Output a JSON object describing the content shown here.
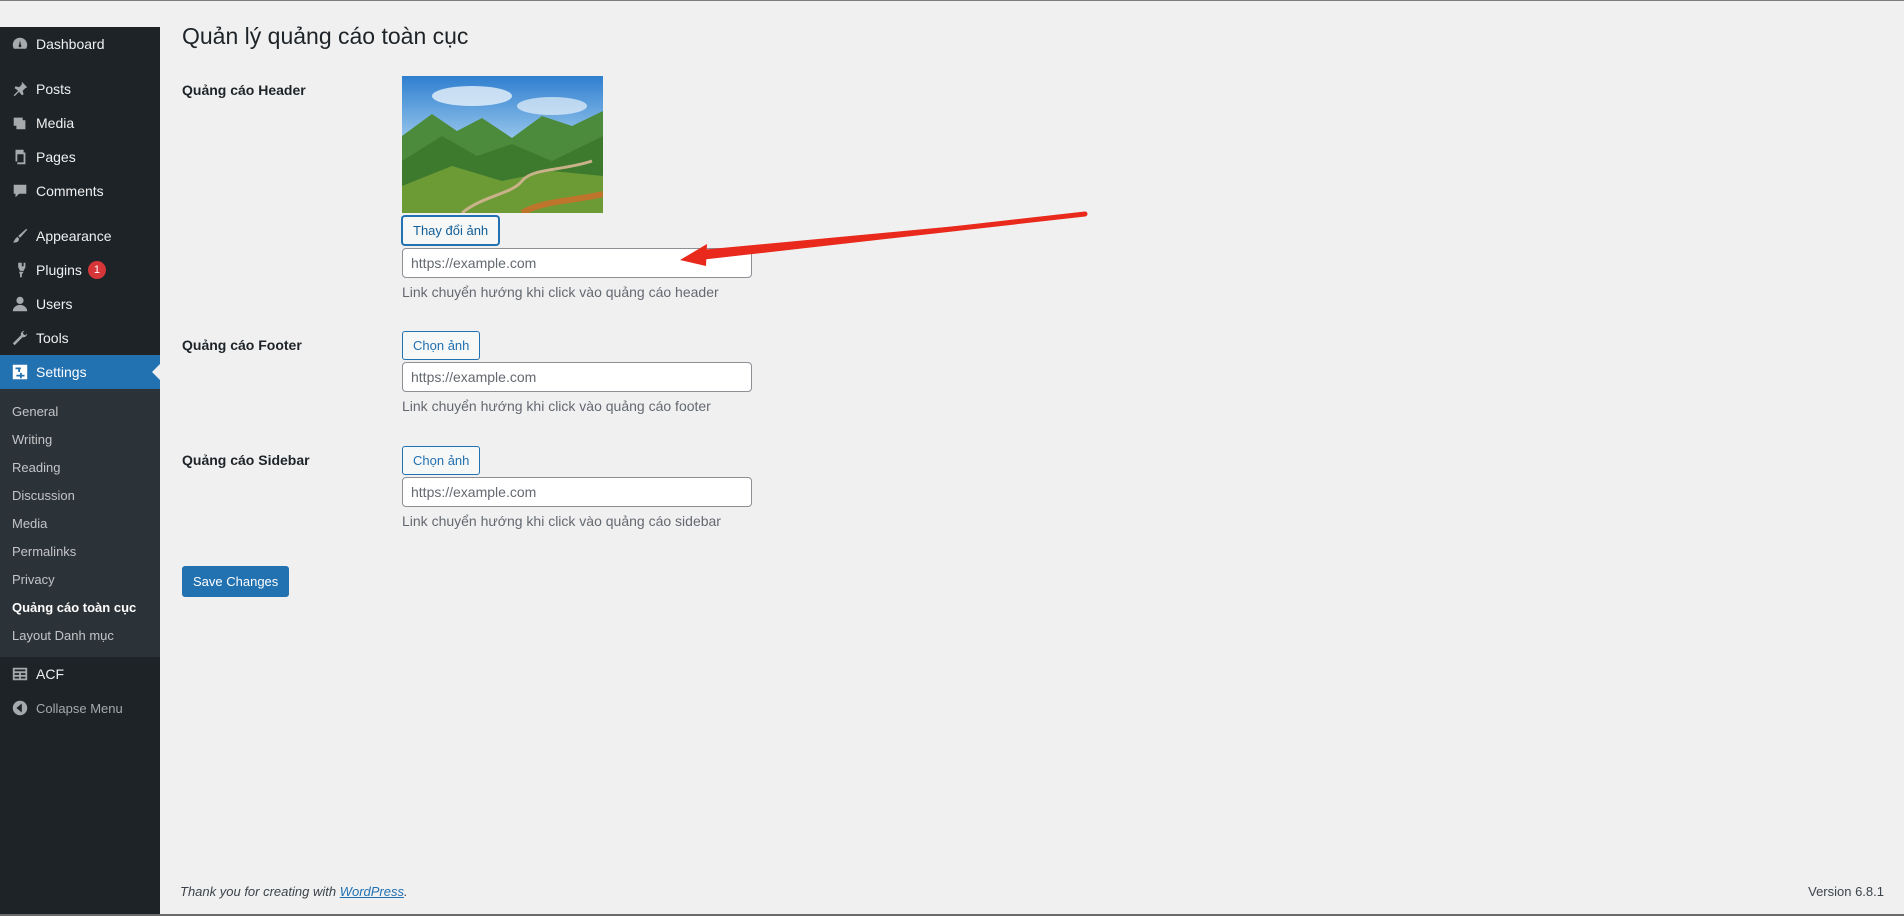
{
  "sidebar": {
    "items": [
      {
        "label": "Dashboard",
        "icon": "dashboard-icon"
      },
      {
        "label": "Posts",
        "icon": "pin-icon"
      },
      {
        "label": "Media",
        "icon": "media-icon"
      },
      {
        "label": "Pages",
        "icon": "pages-icon"
      },
      {
        "label": "Comments",
        "icon": "comment-icon"
      },
      {
        "label": "Appearance",
        "icon": "brush-icon"
      },
      {
        "label": "Plugins",
        "icon": "plugin-icon",
        "badge": "1"
      },
      {
        "label": "Users",
        "icon": "user-icon"
      },
      {
        "label": "Tools",
        "icon": "wrench-icon"
      },
      {
        "label": "Settings",
        "icon": "settings-icon"
      }
    ],
    "submenu": [
      "General",
      "Writing",
      "Reading",
      "Discussion",
      "Media",
      "Permalinks",
      "Privacy",
      "Quảng cáo toàn cục",
      "Layout Danh mục"
    ],
    "acf": "ACF",
    "collapse": "Collapse Menu"
  },
  "page": {
    "title": "Quản lý quảng cáo toàn cục",
    "header": {
      "label": "Quảng cáo Header",
      "button": "Thay đổi ảnh",
      "placeholder": "https://example.com",
      "description": "Link chuyển hướng khi click vào quảng cáo header"
    },
    "footer": {
      "label": "Quảng cáo Footer",
      "button": "Chọn ảnh",
      "placeholder": "https://example.com",
      "description": "Link chuyển hướng khi click vào quảng cáo footer"
    },
    "sidebar_ad": {
      "label": "Quảng cáo Sidebar",
      "button": "Chọn ảnh",
      "placeholder": "https://example.com",
      "description": "Link chuyển hướng khi click vào quảng cáo sidebar"
    },
    "save_label": "Save Changes"
  },
  "footer": {
    "thanks_prefix": "Thank you for creating with ",
    "wordpress_link": "WordPress",
    "thanks_suffix": ".",
    "version": "Version 6.8.1"
  },
  "colors": {
    "admin_bar": "#1d2327",
    "accent": "#2271b1",
    "annotation_arrow": "#e8291c"
  }
}
